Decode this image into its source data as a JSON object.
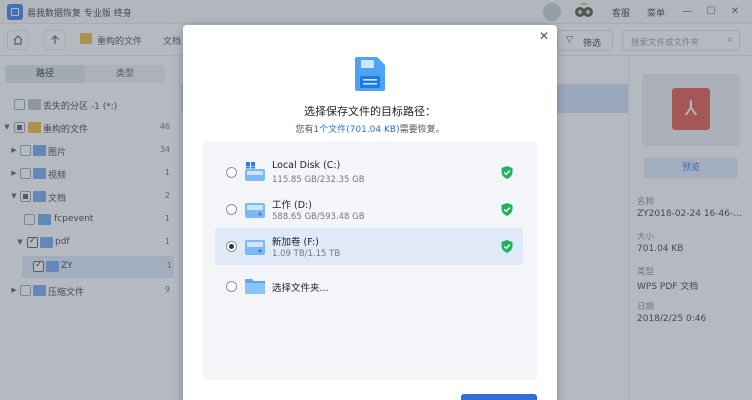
{
  "app": {
    "title": "易我数据恢复 专业版 终身",
    "header_links": [
      "客服",
      "菜单"
    ],
    "window_controls": {
      "minimize": "—",
      "maximize": "☐",
      "close": "✕"
    }
  },
  "toolbar": {
    "home_icon": "home-icon",
    "up_icon": "up-arrow-icon",
    "breadcrumbs": [
      "重构的文件",
      "文档"
    ],
    "filter_label": "筛选",
    "search_placeholder": "搜索文件或文件夹"
  },
  "sidebar": {
    "tabs": [
      "路径",
      "类型"
    ],
    "active_tab": "路径",
    "tree": [
      {
        "label": "丢失的分区 -1 (*:)",
        "count": ""
      },
      {
        "label": "重构的文件",
        "count": "46"
      },
      {
        "label": "图片",
        "count": "34"
      },
      {
        "label": "视频",
        "count": "1"
      },
      {
        "label": "文档",
        "count": "2"
      },
      {
        "label": "fcpevent",
        "count": "1"
      },
      {
        "label": "pdf",
        "count": "1"
      },
      {
        "label": "ZY",
        "count": "1"
      },
      {
        "label": "压缩文件",
        "count": "9"
      }
    ]
  },
  "details": {
    "preview_label": "预览",
    "fields": [
      {
        "key": "名称",
        "value": "ZY2018-02-24 16-46-..."
      },
      {
        "key": "大小",
        "value": "701.04 KB"
      },
      {
        "key": "类型",
        "value": "WPS PDF 文档"
      },
      {
        "key": "日期",
        "value": "2018/2/25 0:46"
      }
    ]
  },
  "dialog": {
    "title": "选择保存文件的目标路径：",
    "subtitle_prefix": "您有",
    "subtitle_highlight": "1个文件(701.04 KB)",
    "subtitle_suffix": "需要恢复。",
    "close_icon": "close-icon",
    "destinations": [
      {
        "name": "Local Disk (C:)",
        "capacity": "115.85 GB/232.35 GB",
        "selected": false,
        "icon": "drive-icon",
        "safe": true
      },
      {
        "name": "工作 (D:)",
        "capacity": "588.65 GB/593.48 GB",
        "selected": false,
        "icon": "drive-icon",
        "safe": true
      },
      {
        "name": "新加卷 (F:)",
        "capacity": "1.09 TB/1.15 TB",
        "selected": true,
        "icon": "drive-icon",
        "safe": true
      },
      {
        "name": "选择文件夹...",
        "capacity": "",
        "selected": false,
        "icon": "folder-icon",
        "safe": false
      }
    ]
  },
  "colors": {
    "accent": "#2f6fd6",
    "safe_green": "#22b35e",
    "selection": "#dfe9f8"
  }
}
